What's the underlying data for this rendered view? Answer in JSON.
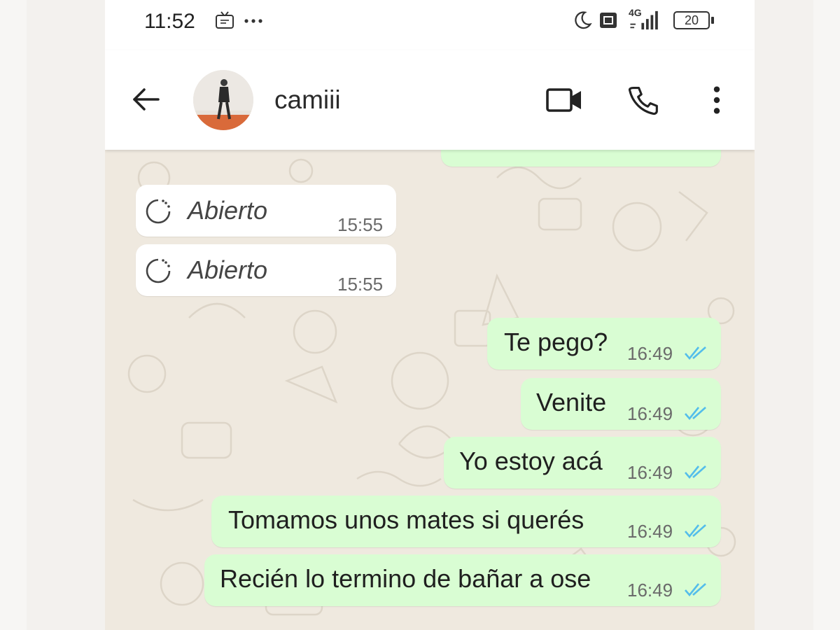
{
  "status_bar": {
    "time": "11:52",
    "battery": "20",
    "network": "4G",
    "icons": [
      "screen-recorder-icon",
      "more-dots-icon",
      "moon-icon",
      "sim-icon",
      "signal-icon",
      "battery-icon"
    ]
  },
  "header": {
    "contact_name": "camiii",
    "icons": [
      "back-arrow-icon",
      "video-call-icon",
      "voice-call-icon",
      "more-vert-icon"
    ]
  },
  "messages": [
    {
      "direction": "in",
      "type": "view-once",
      "text": "Abierto",
      "time": "15:55"
    },
    {
      "direction": "in",
      "type": "view-once",
      "text": "Abierto",
      "time": "15:55"
    },
    {
      "direction": "out",
      "text": "Te pego?",
      "time": "16:49",
      "status": "read"
    },
    {
      "direction": "out",
      "text": "Venite",
      "time": "16:49",
      "status": "read"
    },
    {
      "direction": "out",
      "text": "Yo estoy acá",
      "time": "16:49",
      "status": "read"
    },
    {
      "direction": "out",
      "text": "Tomamos unos mates si querés",
      "time": "16:49",
      "status": "read"
    },
    {
      "direction": "out",
      "text": "Recién lo termino de bañar a ose",
      "time": "16:49",
      "status": "read"
    }
  ],
  "colors": {
    "outgoing_bubble": "#d9fdd3",
    "incoming_bubble": "#ffffff",
    "read_ticks": "#53bdeb",
    "chat_background": "#efe9df"
  }
}
